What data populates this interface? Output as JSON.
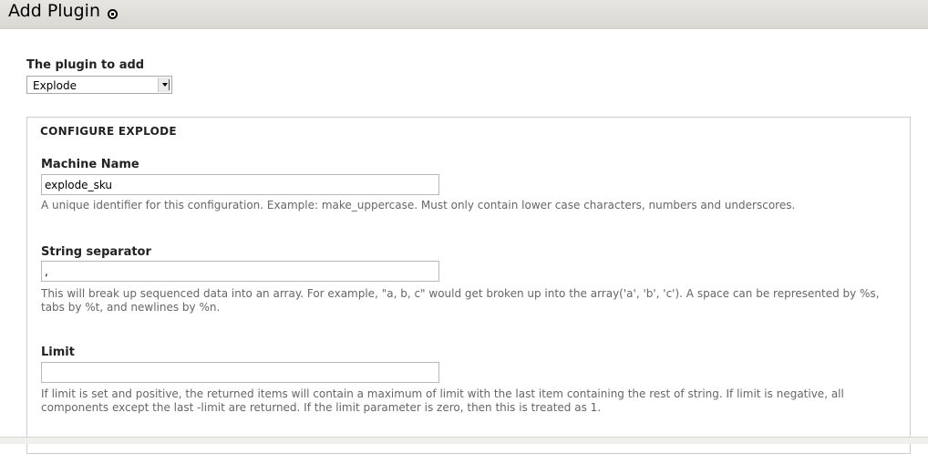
{
  "header": {
    "title": "Add Plugin",
    "icon": "settings-toggle-icon"
  },
  "plugin_select": {
    "label": "The plugin to add",
    "selected": "Explode"
  },
  "config": {
    "legend": "CONFIGURE EXPLODE",
    "machine_name": {
      "label": "Machine Name",
      "value": "explode_sku",
      "description": "A unique identifier for this configuration. Example: make_uppercase. Must only contain lower case characters, numbers and underscores."
    },
    "separator": {
      "label": "String separator",
      "value": ",",
      "description": "This will break up sequenced data into an array. For example, \"a, b, c\" would get broken up into the array('a', 'b', 'c'). A space can be represented by %s, tabs by %t, and newlines by %n."
    },
    "limit": {
      "label": "Limit",
      "value": "",
      "description": "If limit is set and positive, the returned items will contain a maximum of limit with the last item containing the rest of string. If limit is negative, all components except the last -limit are returned. If the limit parameter is zero, then this is treated as 1."
    }
  }
}
